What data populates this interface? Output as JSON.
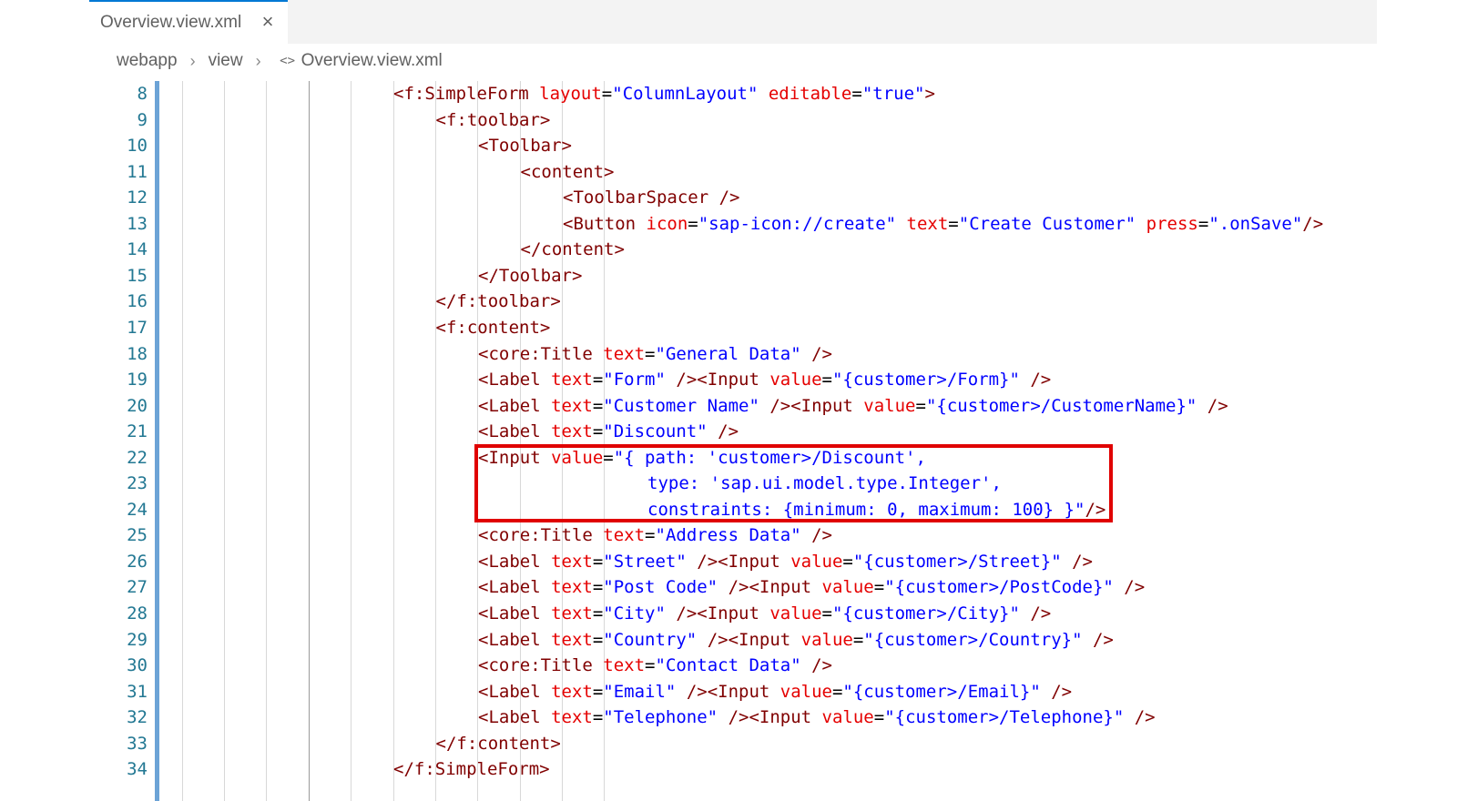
{
  "tab": {
    "title": "Overview.view.xml",
    "close_icon": "close-icon"
  },
  "breadcrumb": {
    "items": [
      "webapp",
      "view"
    ],
    "file_icon": "<>",
    "file": "Overview.view.xml"
  },
  "colors": {
    "tag": "#800000",
    "attr": "#e50000",
    "string": "#0000ff",
    "line_number": "#237893",
    "highlight": "#e00000",
    "gutter_marker": "#6ca3d6"
  },
  "lines": [
    {
      "num": "8",
      "indent": 5,
      "tokens": [
        [
          "tag",
          "<f:SimpleForm "
        ],
        [
          "attr",
          "layout"
        ],
        [
          "eq",
          "="
        ],
        [
          "str",
          "\"ColumnLayout\""
        ],
        [
          "tag",
          " "
        ],
        [
          "attr",
          "editable"
        ],
        [
          "eq",
          "="
        ],
        [
          "str",
          "\"true\""
        ],
        [
          "tag",
          ">"
        ]
      ]
    },
    {
      "num": "9",
      "indent": 6,
      "tokens": [
        [
          "tag",
          "<f:toolbar>"
        ]
      ]
    },
    {
      "num": "10",
      "indent": 7,
      "tokens": [
        [
          "tag",
          "<Toolbar>"
        ]
      ]
    },
    {
      "num": "11",
      "indent": 8,
      "tokens": [
        [
          "tag",
          "<content>"
        ]
      ]
    },
    {
      "num": "12",
      "indent": 9,
      "tokens": [
        [
          "tag",
          "<ToolbarSpacer />"
        ]
      ]
    },
    {
      "num": "13",
      "indent": 9,
      "tokens": [
        [
          "tag",
          "<Button "
        ],
        [
          "attr",
          "icon"
        ],
        [
          "eq",
          "="
        ],
        [
          "str",
          "\"sap-icon://create\""
        ],
        [
          "tag",
          " "
        ],
        [
          "attr",
          "text"
        ],
        [
          "eq",
          "="
        ],
        [
          "str",
          "\"Create Customer\""
        ],
        [
          "tag",
          " "
        ],
        [
          "attr",
          "press"
        ],
        [
          "eq",
          "="
        ],
        [
          "str",
          "\".onSave\""
        ],
        [
          "tag",
          "/>"
        ]
      ]
    },
    {
      "num": "14",
      "indent": 8,
      "tokens": [
        [
          "tag",
          "</content>"
        ]
      ]
    },
    {
      "num": "15",
      "indent": 7,
      "tokens": [
        [
          "tag",
          "</Toolbar>"
        ]
      ]
    },
    {
      "num": "16",
      "indent": 6,
      "tokens": [
        [
          "tag",
          "</f:toolbar>"
        ]
      ]
    },
    {
      "num": "17",
      "indent": 6,
      "tokens": [
        [
          "tag",
          "<f:content>"
        ]
      ]
    },
    {
      "num": "18",
      "indent": 7,
      "tokens": [
        [
          "tag",
          "<core:Title "
        ],
        [
          "attr",
          "text"
        ],
        [
          "eq",
          "="
        ],
        [
          "str",
          "\"General Data\""
        ],
        [
          "tag",
          " />"
        ]
      ]
    },
    {
      "num": "19",
      "indent": 7,
      "tokens": [
        [
          "tag",
          "<Label "
        ],
        [
          "attr",
          "text"
        ],
        [
          "eq",
          "="
        ],
        [
          "str",
          "\"Form\""
        ],
        [
          "tag",
          " /><Input "
        ],
        [
          "attr",
          "value"
        ],
        [
          "eq",
          "="
        ],
        [
          "str",
          "\"{customer>/Form}\""
        ],
        [
          "tag",
          " />"
        ]
      ]
    },
    {
      "num": "20",
      "indent": 7,
      "tokens": [
        [
          "tag",
          "<Label "
        ],
        [
          "attr",
          "text"
        ],
        [
          "eq",
          "="
        ],
        [
          "str",
          "\"Customer Name\""
        ],
        [
          "tag",
          " /><Input "
        ],
        [
          "attr",
          "value"
        ],
        [
          "eq",
          "="
        ],
        [
          "str",
          "\"{customer>/CustomerName}\""
        ],
        [
          "tag",
          " />"
        ]
      ]
    },
    {
      "num": "21",
      "indent": 7,
      "tokens": [
        [
          "tag",
          "<Label "
        ],
        [
          "attr",
          "text"
        ],
        [
          "eq",
          "="
        ],
        [
          "str",
          "\"Discount\""
        ],
        [
          "tag",
          " />"
        ]
      ]
    },
    {
      "num": "22",
      "indent": 7,
      "tokens": [
        [
          "tag",
          "<Input "
        ],
        [
          "attr",
          "value"
        ],
        [
          "eq",
          "="
        ],
        [
          "str",
          "\"{ path: 'customer>/Discount',"
        ]
      ]
    },
    {
      "num": "23",
      "indent": 11,
      "tokens": [
        [
          "str",
          "type: 'sap.ui.model.type.Integer',"
        ]
      ]
    },
    {
      "num": "24",
      "indent": 11,
      "tokens": [
        [
          "str",
          "constraints: {minimum: 0, maximum: 100} }\""
        ],
        [
          "tag",
          "/>"
        ]
      ]
    },
    {
      "num": "25",
      "indent": 7,
      "tokens": [
        [
          "tag",
          "<core:Title "
        ],
        [
          "attr",
          "text"
        ],
        [
          "eq",
          "="
        ],
        [
          "str",
          "\"Address Data\""
        ],
        [
          "tag",
          " />"
        ]
      ]
    },
    {
      "num": "26",
      "indent": 7,
      "tokens": [
        [
          "tag",
          "<Label "
        ],
        [
          "attr",
          "text"
        ],
        [
          "eq",
          "="
        ],
        [
          "str",
          "\"Street\""
        ],
        [
          "tag",
          " /><Input "
        ],
        [
          "attr",
          "value"
        ],
        [
          "eq",
          "="
        ],
        [
          "str",
          "\"{customer>/Street}\""
        ],
        [
          "tag",
          " />"
        ]
      ]
    },
    {
      "num": "27",
      "indent": 7,
      "tokens": [
        [
          "tag",
          "<Label "
        ],
        [
          "attr",
          "text"
        ],
        [
          "eq",
          "="
        ],
        [
          "str",
          "\"Post Code\""
        ],
        [
          "tag",
          " /><Input "
        ],
        [
          "attr",
          "value"
        ],
        [
          "eq",
          "="
        ],
        [
          "str",
          "\"{customer>/PostCode}\""
        ],
        [
          "tag",
          " />"
        ]
      ]
    },
    {
      "num": "28",
      "indent": 7,
      "tokens": [
        [
          "tag",
          "<Label "
        ],
        [
          "attr",
          "text"
        ],
        [
          "eq",
          "="
        ],
        [
          "str",
          "\"City\""
        ],
        [
          "tag",
          " /><Input "
        ],
        [
          "attr",
          "value"
        ],
        [
          "eq",
          "="
        ],
        [
          "str",
          "\"{customer>/City}\""
        ],
        [
          "tag",
          " />"
        ]
      ]
    },
    {
      "num": "29",
      "indent": 7,
      "tokens": [
        [
          "tag",
          "<Label "
        ],
        [
          "attr",
          "text"
        ],
        [
          "eq",
          "="
        ],
        [
          "str",
          "\"Country\""
        ],
        [
          "tag",
          " /><Input "
        ],
        [
          "attr",
          "value"
        ],
        [
          "eq",
          "="
        ],
        [
          "str",
          "\"{customer>/Country}\""
        ],
        [
          "tag",
          " />"
        ]
      ]
    },
    {
      "num": "30",
      "indent": 7,
      "tokens": [
        [
          "tag",
          "<core:Title "
        ],
        [
          "attr",
          "text"
        ],
        [
          "eq",
          "="
        ],
        [
          "str",
          "\"Contact Data\""
        ],
        [
          "tag",
          " />"
        ]
      ]
    },
    {
      "num": "31",
      "indent": 7,
      "tokens": [
        [
          "tag",
          "<Label "
        ],
        [
          "attr",
          "text"
        ],
        [
          "eq",
          "="
        ],
        [
          "str",
          "\"Email\""
        ],
        [
          "tag",
          " /><Input "
        ],
        [
          "attr",
          "value"
        ],
        [
          "eq",
          "="
        ],
        [
          "str",
          "\"{customer>/Email}\""
        ],
        [
          "tag",
          " />"
        ]
      ]
    },
    {
      "num": "32",
      "indent": 7,
      "tokens": [
        [
          "tag",
          "<Label "
        ],
        [
          "attr",
          "text"
        ],
        [
          "eq",
          "="
        ],
        [
          "str",
          "\"Telephone\""
        ],
        [
          "tag",
          " /><Input "
        ],
        [
          "attr",
          "value"
        ],
        [
          "eq",
          "="
        ],
        [
          "str",
          "\"{customer>/Telephone}\""
        ],
        [
          "tag",
          " />"
        ]
      ]
    },
    {
      "num": "33",
      "indent": 6,
      "tokens": [
        [
          "tag",
          "</f:content>"
        ]
      ]
    },
    {
      "num": "34",
      "indent": 5,
      "tokens": [
        [
          "tag",
          "</f:SimpleForm>"
        ]
      ]
    }
  ]
}
